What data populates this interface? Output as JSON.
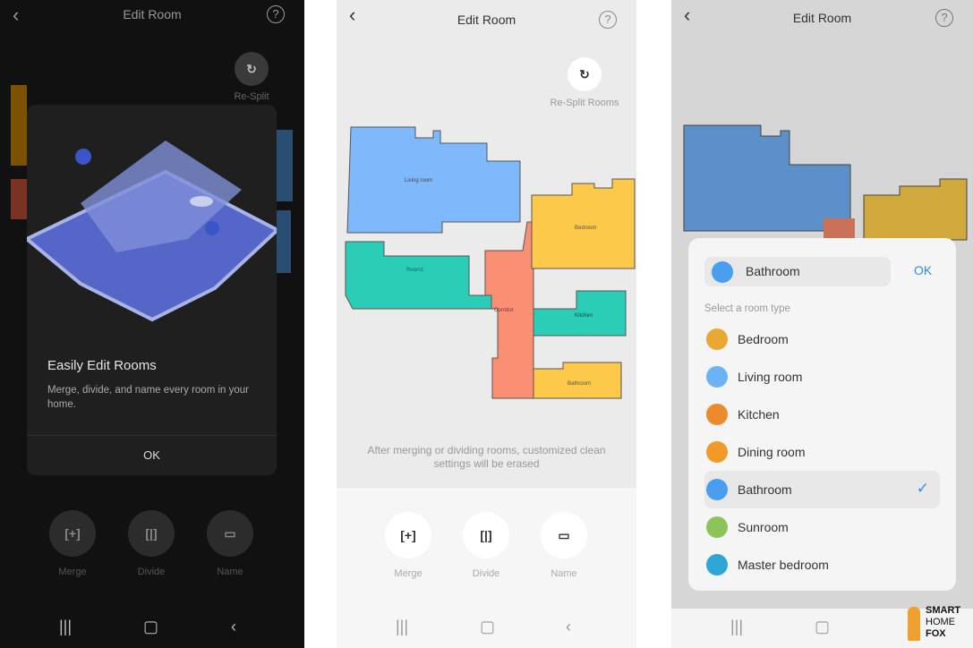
{
  "header": {
    "title": "Edit Room",
    "help_icon": "help-circle-icon",
    "back_icon": "chevron-left-icon"
  },
  "panel1": {
    "resplit_label": "Re-Split",
    "dialog": {
      "title": "Easily Edit Rooms",
      "body": "Merge, divide, and name every room in your home.",
      "ok": "OK"
    }
  },
  "panel2": {
    "resplit_label": "Re-Split Rooms",
    "rooms": [
      "Living room",
      "Bedroom",
      "Room1",
      "Corridor",
      "Kitchen",
      "Bathroom"
    ],
    "notice": "After merging or dividing rooms, customized clean settings will be erased"
  },
  "toolbar": {
    "merge": "Merge",
    "divide": "Divide",
    "name": "Name"
  },
  "panel3": {
    "current_value": "Bathroom",
    "ok": "OK",
    "section_label": "Select a room type",
    "selected": "Bathroom",
    "room_types": [
      {
        "label": "Bedroom",
        "color": "#e8a833"
      },
      {
        "label": "Living room",
        "color": "#6bb3f5"
      },
      {
        "label": "Kitchen",
        "color": "#ec8a2e"
      },
      {
        "label": "Dining room",
        "color": "#f09a2a"
      },
      {
        "label": "Bathroom",
        "color": "#4a9ef0"
      },
      {
        "label": "Sunroom",
        "color": "#8cc45a"
      },
      {
        "label": "Master bedroom",
        "color": "#2ea6d6"
      }
    ]
  },
  "colors": {
    "accent": "#2d8ef0",
    "living": "#7fb8fb",
    "bedroom": "#fcc94a",
    "room": "#2ccdb7",
    "corridor": "#fb8f73"
  },
  "watermark": "SMART HOME FOX"
}
